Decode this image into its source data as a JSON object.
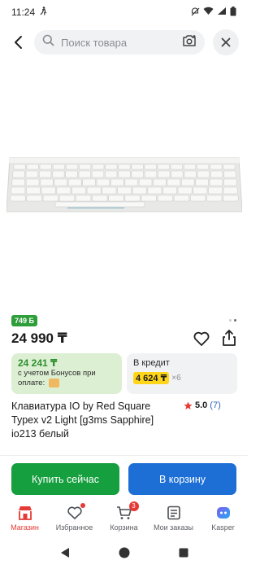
{
  "status_bar": {
    "time": "11:24"
  },
  "search": {
    "placeholder": "Поиск товара"
  },
  "product": {
    "bonus_chip": "749 Б",
    "price": "24 990 ₸",
    "bonus": {
      "amount": "24 241 ₸",
      "description": "с учетом Бонусов при оплате:"
    },
    "credit": {
      "label": "В кредит",
      "amount": "4 624 ₸",
      "months": "×6"
    },
    "title": "Клавиатура IO by Red Square Typex v2 Light [g3ms Sapphire] io213 белый",
    "rating": {
      "value": "5.0",
      "count": "(7)"
    },
    "gallery_dots": 2,
    "gallery_active": 1
  },
  "actions": {
    "buy_now": "Купить сейчас",
    "add_to_cart": "В корзину"
  },
  "tab_bar": {
    "items": [
      {
        "label": "Магазин",
        "icon": "shop-icon",
        "active": true
      },
      {
        "label": "Избранное",
        "icon": "heart-icon",
        "active": false
      },
      {
        "label": "Корзина",
        "icon": "cart-icon",
        "active": false,
        "badge": "3"
      },
      {
        "label": "Мои заказы",
        "icon": "orders-icon",
        "active": false
      },
      {
        "label": "Kasper",
        "icon": "kaspi-assistant-icon",
        "active": false
      }
    ]
  },
  "colors": {
    "buy_green": "#169f3f",
    "cart_blue": "#1d6fd6",
    "accent_red": "#e53a35",
    "bonus_bg": "#dcefd2",
    "credit_highlight": "#ffd51a"
  }
}
